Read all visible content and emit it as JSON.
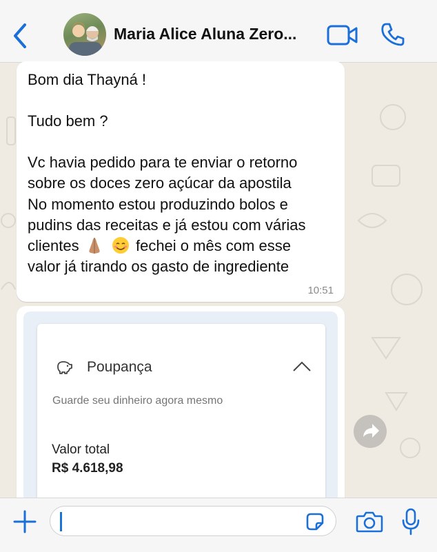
{
  "header": {
    "contact_name": "Maria Alice Aluna Zero...",
    "back_icon": "chevron-left-icon",
    "video_icon": "video-camera-icon",
    "call_icon": "phone-icon",
    "accent": "#1b6fd8"
  },
  "message": {
    "lines": {
      "l1": "Bom dia Thayná !",
      "l2": "Tudo bem ?",
      "l3": "Vc havia pedido para te enviar o retorno",
      "l4": "sobre os doces zero açúcar da apostila",
      "l5": "No momento estou produzindo bolos e",
      "l6": "pudins das receitas e já estou com várias",
      "l7a": "clientes",
      "l7b": "fechei o mês com esse",
      "l8": "valor já tirando os gasto de ingrediente"
    },
    "emojis": [
      "folded-hands-icon",
      "smiling-face-icon"
    ],
    "time": "10:51"
  },
  "image": {
    "card_title": "Poupança",
    "card_subtitle": "Guarde seu dinheiro agora mesmo",
    "total_label": "Valor total",
    "total_value": "R$ 4.618,98"
  },
  "composer": {
    "input_value": "",
    "plus_icon": "plus-icon",
    "sticker_icon": "sticker-icon",
    "camera_icon": "camera-icon",
    "mic_icon": "microphone-icon"
  }
}
